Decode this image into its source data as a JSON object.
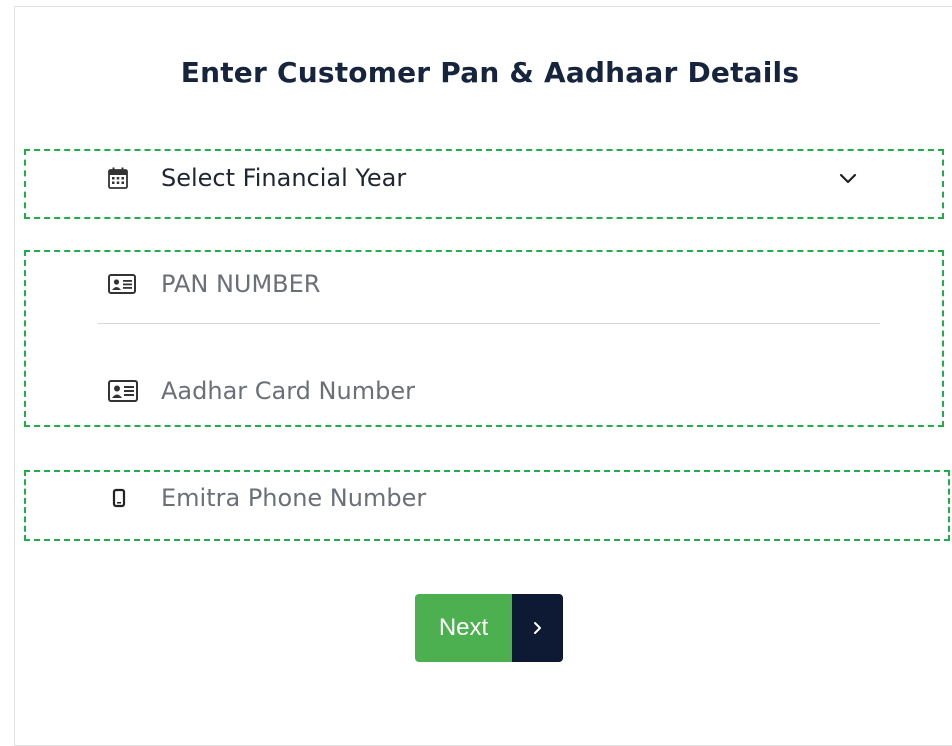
{
  "form": {
    "title": "Enter Customer Pan & Aadhaar Details",
    "financial_year": {
      "label": "Select Financial Year",
      "icon": "calendar-icon"
    },
    "pan": {
      "placeholder": "PAN NUMBER",
      "icon": "id-card-icon"
    },
    "aadhar": {
      "placeholder": "Aadhar Card Number",
      "icon": "id-card-icon"
    },
    "phone": {
      "placeholder": "Emitra Phone Number",
      "icon": "mobile-phone-icon"
    },
    "next_button": {
      "label": "Next",
      "icon": "chevron-right-icon"
    }
  },
  "colors": {
    "highlight_border": "#1fae4a",
    "next_button_bg": "#4caf50",
    "next_arrow_bg": "#0e1a33",
    "title": "#17243e"
  }
}
